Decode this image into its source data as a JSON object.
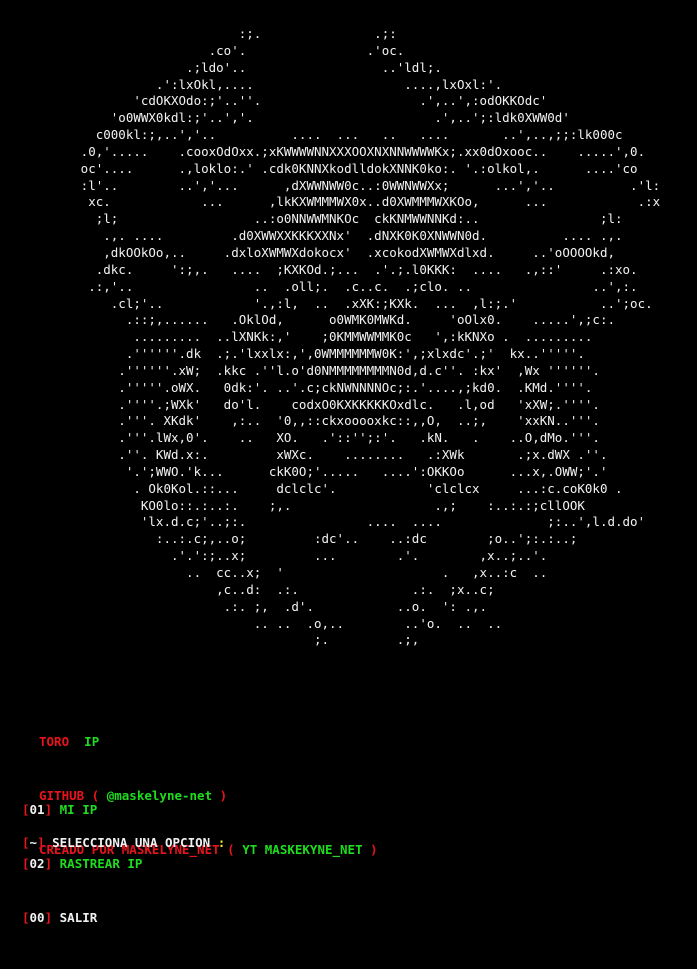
{
  "ascii_art": "                            :;.               .;:\n                        .co'.                .'oc.\n                     .;ldo'..                  ..'ldl;.\n                 .':lxOkl,....                    ....,lxOxl:'.\n              'cdOKXOdo:;'..''.                     .',..',:odOKKOdc'\n           'o0WWX0kdl:;'..','.                        .',..';:ldk0XWW0d'\n         c000kl:;,..','..          ....  ...   ..   ....       ..',..,;;:lk000c\n       .0,'.....    .cooxOdOxx.;xKWWWWNNXXXOOXNXNNWWWWKx;.xx0dOxooc..    .....',0.\n       oc'....      .,loklo:.' .cdk0KNNXkodlldokXNNK0ko:. '.:olkol,.      ....'co\n       :l'..        ..','...      ,dXWWNWW0c..:0WWNWWXx;      ...','..          .'l:\n        xc.            ...      ,lkKXWMMMWX0x..d0XWMMMWXKOo,      ...            .:x\n         ;l;                  ..:o0NNWWMNKOc  ckKNMWWNNKd:..                ;l:\n          .,. ....         .d0XWWXXKKKXXNx'  .dNXK0K0XNWWN0d.          .... .,.\n          ,dkOOkOo,..     .dxloXWMWXdokocx'  .xcokodXWMWXdlxd.     ..'oOOOOkd,\n         .dkc.     ':;,.   ....  ;KXKOd.;...  .'.;.l0KKK:  ....   .,::'     .:xo.\n        .:,'..                ..  .oll;.  .c..c.  .;clo. ..                ..',:.\n           .cl;'..            '.,:l,  ..  .xXK:;KXk.  ...  ,l:;.'           ..';oc.\n             .::;,......   .OklOd,      o0WMK0MWKd.     'oOlx0.    .....',;c:.\n              .........  ..lXNKk:,'    ;0KMMWWMMK0c   ',:kKNXo .  .........\n             .''''''.dk  .;.'lxxlx:,',0WMMMMMMW0K:',;xlxdc'.;'  kx..'''''.\n            .''''''.xW;  .kkc .''l.o'd0NMMMMMMMMN0d,d.c''. :kx'  ,Wx ''''''.\n            .'''''.oWX.   0dk:'. ..'.c;ckNWNNNNOc;:.'....,;kd0.  .KMd.''''.\n            .''''.;WXk'   do'l.    codxO0KXKKKKKOxdlc.   .l,od   'xXW;.''''.\n            .'''. XKdk'    ,:..  '0,,::ckxooooxkc::,,O,  ..;,    'xxKN..'''.\n            .'''.lWx,0'.    ..   XO.   .'::'';:'.   .kN.   .    ..O,dMo.'''.\n            .''. KWd.x:.         xWXc.    ........   .:XWk       .;x.dWX .''.\n             '.';WWO.'k...      ckK0O;'.....   ....':OKKOo      ...x,.OWW;'.'\n              . Ok0Kol.::...     dclclc'.            'clclcx     ...:c.coK0k0 .\n               KO0lo::.:..:.    ;,.                   .,;    :..:.:;cllOOK\n               'lx.d.c;'..;:.                ....  ....              ;:..',l.d.do'\n                 :..:.c;,..o;         :dc'..    ..:dc        ;o..';:.:..;\n                   .'.':;..x;         ...        .'.        ,x..;..'.\n                     ..  cc..x;  '                     .   ,x..:c  ..\n                         ,c..d:  .:.               .:.  ;x..c;\n                          .:. ;,  .d'.           ..o.  ': .,.\n                              .. ..  .o,..        ..'o.  ..  ..\n                                      ;.         .;,",
  "info": {
    "toro_label": "TORO",
    "ip_label": "IP",
    "github_prefix": "GITHUB ( ",
    "github_handle": "@maskelyne-net",
    "github_suffix": " )",
    "creado_prefix": "CREADO POR MASKELYNE_NET ( ",
    "creado_channel": "YT MASKEKYNE_NET",
    "creado_suffix": " )"
  },
  "menu": {
    "items": [
      {
        "num": "01",
        "label": "MI IP"
      },
      {
        "num": "02",
        "label": "RASTREAR IP"
      },
      {
        "num": "00",
        "label": "SALIR"
      }
    ]
  },
  "prompt": {
    "symbol": "~",
    "text": "SELECCIONA UNA OPCION",
    "colon": ":"
  },
  "colors": {
    "background": "#000000",
    "red": "#e8141c",
    "green": "#1fdc1f",
    "white": "#f2f2f2",
    "yellow": "#e8e838"
  }
}
